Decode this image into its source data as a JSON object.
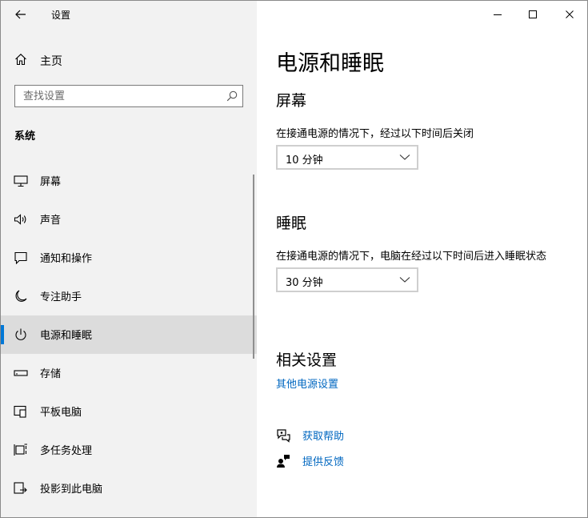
{
  "window": {
    "title": "设置"
  },
  "sidebar": {
    "home_label": "主页",
    "search_placeholder": "查找设置",
    "section_label": "系统",
    "items": [
      {
        "label": "屏幕",
        "icon": "monitor-icon"
      },
      {
        "label": "声音",
        "icon": "speaker-icon"
      },
      {
        "label": "通知和操作",
        "icon": "notification-icon"
      },
      {
        "label": "专注助手",
        "icon": "moon-icon"
      },
      {
        "label": "电源和睡眠",
        "icon": "power-icon",
        "selected": true
      },
      {
        "label": "存储",
        "icon": "storage-icon"
      },
      {
        "label": "平板电脑",
        "icon": "tablet-icon"
      },
      {
        "label": "多任务处理",
        "icon": "multitask-icon"
      },
      {
        "label": "投影到此电脑",
        "icon": "project-icon"
      }
    ]
  },
  "main": {
    "title": "电源和睡眠",
    "screen": {
      "heading": "屏幕",
      "description": "在接通电源的情况下，经过以下时间后关闭",
      "value": "10 分钟"
    },
    "sleep": {
      "heading": "睡眠",
      "description": "在接通电源的情况下，电脑在经过以下时间后进入睡眠状态",
      "value": "30 分钟"
    },
    "related": {
      "heading": "相关设置",
      "link": "其他电源设置"
    },
    "help": {
      "get_help": "获取帮助",
      "feedback": "提供反馈"
    }
  },
  "colors": {
    "accent": "#0078d7",
    "link": "#0067c0",
    "sidebar_bg": "#f2f2f2",
    "selected_bg": "#dcdcdc"
  }
}
